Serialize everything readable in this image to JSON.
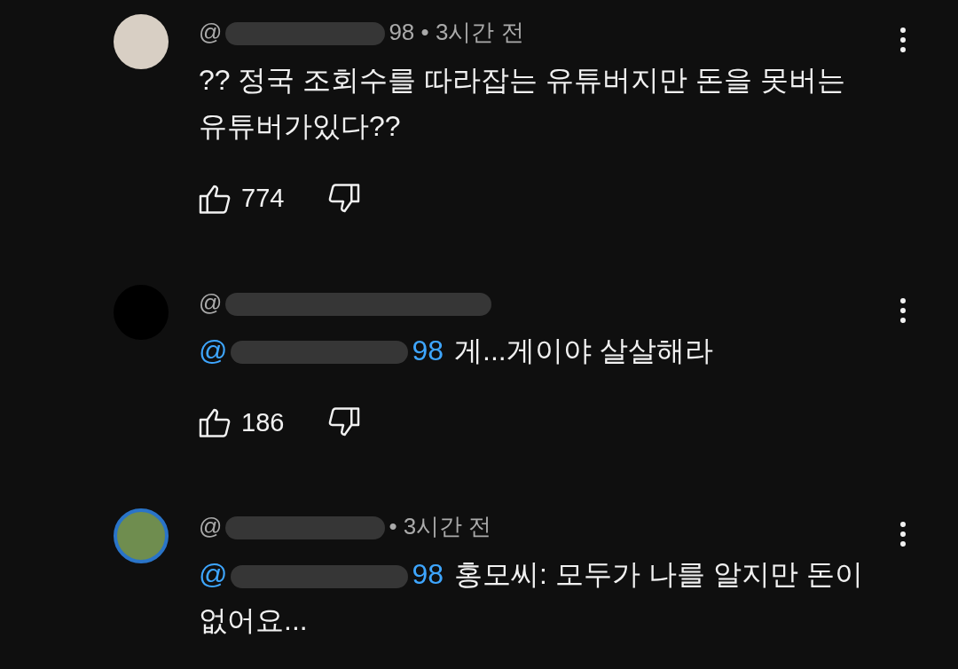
{
  "comments": [
    {
      "avatar": {
        "kind": "photo"
      },
      "author_prefix": "@",
      "author_suffix": "98 • 3시간 전",
      "body": "?? 정국 조회수를 따라잡는 유튜버지만 돈을 못버는 유튜버가있다??",
      "likes": "774"
    },
    {
      "avatar": {
        "kind": "plain"
      },
      "author_prefix": "@",
      "mention": {
        "prefix": "@",
        "suffix": "98"
      },
      "body": "게...게이야 살살해라",
      "likes": "186"
    },
    {
      "avatar": {
        "kind": "cartoon"
      },
      "author_prefix": "@",
      "author_suffix": "• 3시간 전",
      "mention": {
        "prefix": "@",
        "suffix": "98"
      },
      "body": "홍모씨: 모두가 나를 알지만 돈이 없어요..."
    }
  ]
}
